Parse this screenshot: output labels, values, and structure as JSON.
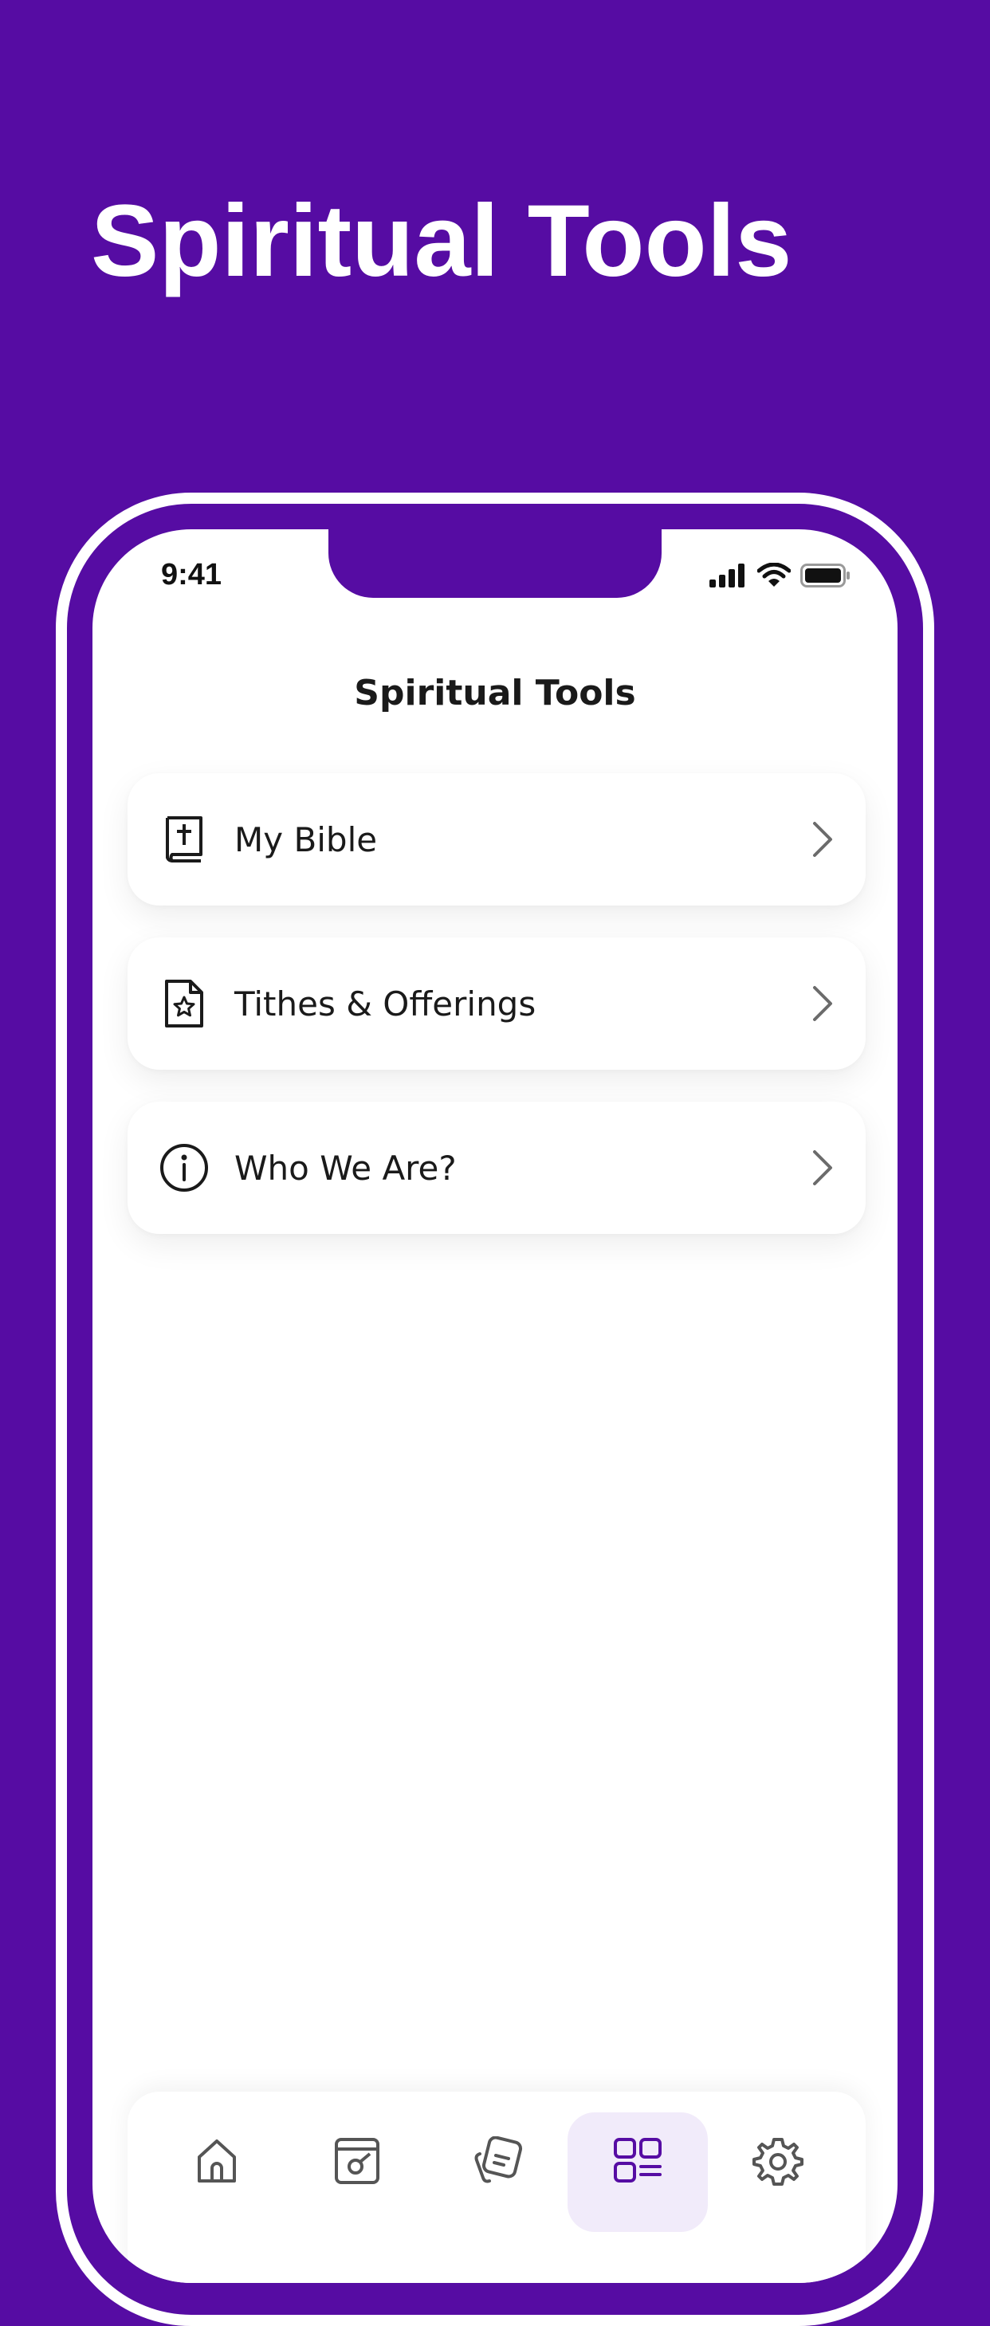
{
  "hero": {
    "title": "Spiritual Tools"
  },
  "status_bar": {
    "time": "9:41"
  },
  "screen": {
    "title": "Spiritual Tools"
  },
  "menu_items": [
    {
      "label": "My Bible",
      "icon": "bible-icon"
    },
    {
      "label": "Tithes & Offerings",
      "icon": "document-star-icon"
    },
    {
      "label": "Who We Are?",
      "icon": "info-icon"
    }
  ],
  "tab_bar": {
    "tabs": [
      {
        "icon": "home-icon",
        "active": false
      },
      {
        "icon": "media-icon",
        "active": false
      },
      {
        "icon": "notes-icon",
        "active": false
      },
      {
        "icon": "grid-icon",
        "active": true
      },
      {
        "icon": "gear-icon",
        "active": false
      }
    ]
  },
  "colors": {
    "brand": "#560ca3",
    "card_background": "#ffffff",
    "active_tab_background": "#f1ebfa",
    "text": "#1a1a1a"
  }
}
